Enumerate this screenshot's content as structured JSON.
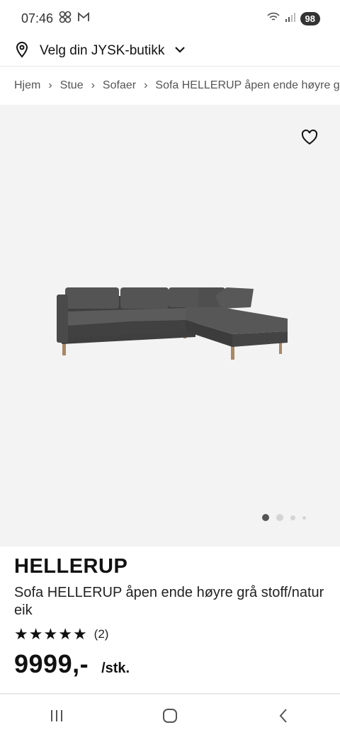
{
  "status_bar": {
    "time": "07:46",
    "battery": "98",
    "icons": [
      "pinwheel-icon",
      "gmail-icon",
      "wifi-icon",
      "signal-icon"
    ]
  },
  "store_selector": {
    "label": "Velg din JYSK-butikk",
    "icon": "location-pin-icon"
  },
  "breadcrumb": [
    "Hjem",
    "Stue",
    "Sofaer",
    "Sofa HELLERUP åpen ende høyre gr"
  ],
  "gallery": {
    "image_count": 4,
    "active_index": 0
  },
  "product": {
    "brand": "HELLERUP",
    "description": "Sofa HELLERUP åpen ende høyre grå stoff/natur eik",
    "rating_stars": 5,
    "rating_count": "(2)",
    "price": "9999,-",
    "unit": "/stk."
  },
  "colors": {
    "sofa_fabric": "#4b4b4b",
    "gallery_bg": "#f3f3f3",
    "text": "#111111"
  }
}
